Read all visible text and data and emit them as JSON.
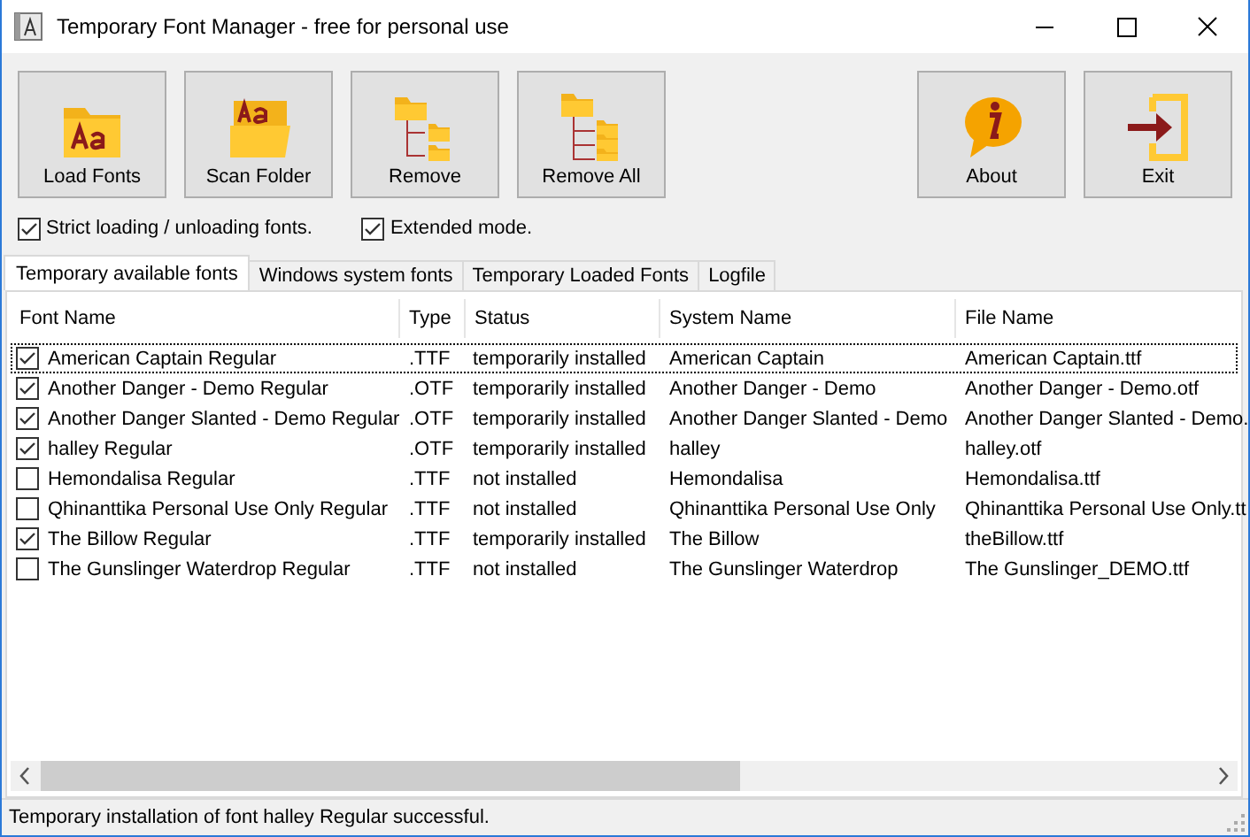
{
  "window": {
    "title": "Temporary Font Manager - free for personal use"
  },
  "toolbar": {
    "file_actions": [
      {
        "kind": "load",
        "label": "Load Fonts"
      },
      {
        "kind": "scan",
        "label": "Scan Folder"
      },
      {
        "kind": "remove",
        "label": "Remove"
      },
      {
        "kind": "removeall",
        "label": "Remove All"
      }
    ],
    "app_actions": [
      {
        "kind": "about",
        "label": "About"
      },
      {
        "kind": "exit",
        "label": "Exit"
      }
    ]
  },
  "options": [
    {
      "label": "Strict loading / unloading fonts.",
      "checked": true
    },
    {
      "label": "Extended mode.",
      "checked": true
    }
  ],
  "tabs": [
    {
      "label": "Temporary available fonts",
      "selected": true
    },
    {
      "label": "Windows system fonts",
      "selected": false
    },
    {
      "label": "Temporary Loaded Fonts",
      "selected": false
    },
    {
      "label": "Logfile",
      "selected": false
    }
  ],
  "table": {
    "columns": [
      "Font Name",
      "Type",
      "Status",
      "System Name",
      "File Name"
    ],
    "rows": [
      {
        "checked": true,
        "focused": true,
        "cells": [
          "American Captain Regular",
          ".TTF",
          "temporarily installed",
          "American Captain",
          "American Captain.ttf"
        ]
      },
      {
        "checked": true,
        "focused": false,
        "cells": [
          "Another Danger - Demo Regular",
          ".OTF",
          "temporarily installed",
          "Another Danger - Demo",
          "Another Danger - Demo.otf"
        ]
      },
      {
        "checked": true,
        "focused": false,
        "cells": [
          "Another Danger Slanted - Demo Regular",
          ".OTF",
          "temporarily installed",
          "Another Danger Slanted - Demo",
          "Another Danger Slanted - Demo."
        ]
      },
      {
        "checked": true,
        "focused": false,
        "cells": [
          "halley Regular",
          ".OTF",
          "temporarily installed",
          "halley",
          "halley.otf"
        ]
      },
      {
        "checked": false,
        "focused": false,
        "cells": [
          "Hemondalisa Regular",
          ".TTF",
          "not installed",
          "Hemondalisa",
          "Hemondalisa.ttf"
        ]
      },
      {
        "checked": false,
        "focused": false,
        "cells": [
          "Qhinanttika Personal Use Only Regular",
          ".TTF",
          "not installed",
          "Qhinanttika Personal Use Only",
          "Qhinanttika Personal Use Only.tt"
        ]
      },
      {
        "checked": true,
        "focused": false,
        "cells": [
          "The Billow Regular",
          ".TTF",
          "temporarily installed",
          "The Billow",
          "theBillow.ttf"
        ]
      },
      {
        "checked": false,
        "focused": false,
        "cells": [
          "The Gunslinger Waterdrop Regular",
          ".TTF",
          "not installed",
          "The Gunslinger Waterdrop",
          "The Gunslinger_DEMO.ttf"
        ]
      }
    ]
  },
  "status_bar": {
    "message": "Temporary installation of font halley Regular successful."
  }
}
